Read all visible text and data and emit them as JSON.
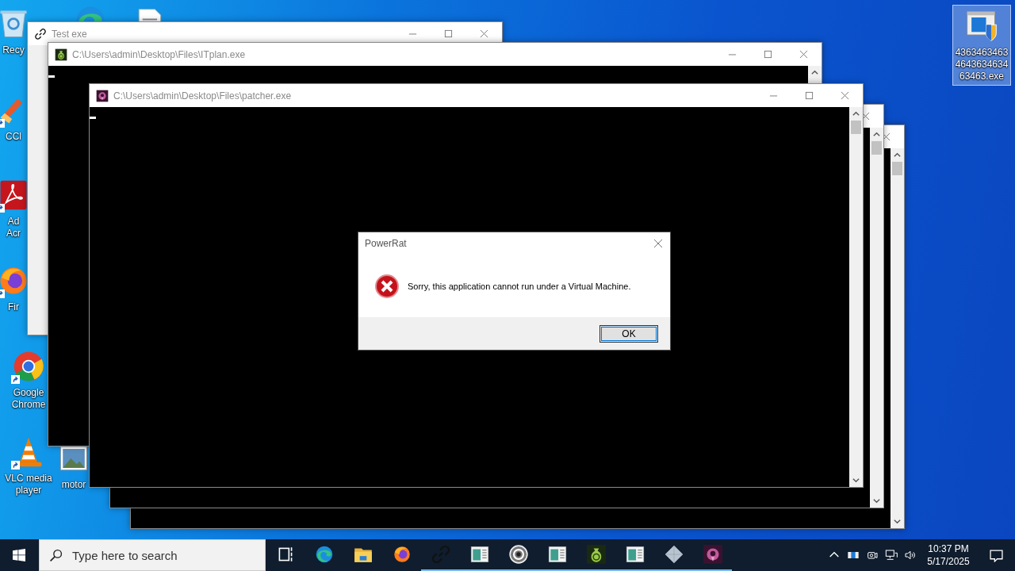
{
  "desktop_icons": [
    {
      "kind": "recycle-bin",
      "lines": [
        "Recy"
      ]
    },
    {
      "kind": "broom",
      "shortcut": true,
      "lines": [
        "CCl"
      ]
    },
    {
      "kind": "acrobat",
      "shortcut": true,
      "lines": [
        "Ad",
        "Acr"
      ]
    },
    {
      "kind": "firefox",
      "shortcut": true,
      "lines": [
        "Fir"
      ]
    },
    {
      "kind": "chrome",
      "shortcut": true,
      "lines": [
        "Google",
        "Chrome"
      ]
    },
    {
      "kind": "vlc",
      "shortcut": true,
      "lines": [
        "VLC media",
        "player"
      ]
    },
    {
      "kind": "edge"
    },
    {
      "kind": "document"
    },
    {
      "kind": "image",
      "lines": [
        "motor"
      ]
    },
    {
      "kind": "installer",
      "selected": true,
      "lines": [
        "4363463463464363463463463.exe"
      ]
    }
  ],
  "windows": [
    {
      "kind": "gui",
      "title": "Test exe"
    },
    {
      "kind": "console",
      "title": "C:\\Users\\admin\\Desktop\\Files\\ITplan.exe"
    },
    {
      "kind": "console"
    },
    {
      "kind": "console"
    },
    {
      "kind": "console",
      "title": "C:\\Users\\admin\\Desktop\\Files\\patcher.exe"
    }
  ],
  "dialog": {
    "title": "PowerRat",
    "message": "Sorry, this application cannot run under a Virtual Machine.",
    "buttons": [
      "OK"
    ]
  },
  "taskbar": {
    "search": {
      "placeholder": "Type here to search"
    },
    "apps": [
      {
        "kind": "task-view",
        "running": false
      },
      {
        "kind": "edge",
        "running": false
      },
      {
        "kind": "folder",
        "running": false
      },
      {
        "kind": "firefox",
        "running": false
      },
      {
        "kind": "link",
        "running": true
      },
      {
        "kind": "app-window",
        "running": true
      },
      {
        "kind": "cc-disc",
        "running": true
      },
      {
        "kind": "app-window",
        "running": true
      },
      {
        "kind": "money-bag",
        "running": true
      },
      {
        "kind": "app-window",
        "running": true
      },
      {
        "kind": "diamond",
        "running": true
      },
      {
        "kind": "purple-emblem",
        "running": true
      }
    ],
    "clock": {
      "time": "10:37 PM",
      "date": "5/17/2025"
    }
  }
}
